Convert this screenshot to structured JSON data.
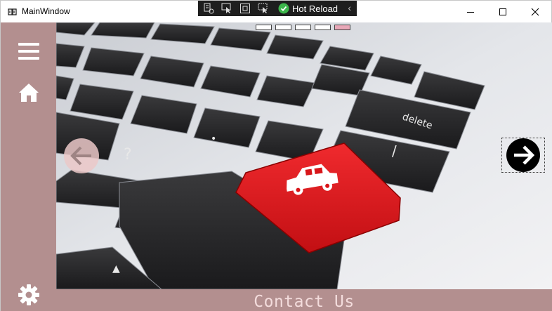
{
  "window": {
    "title": "MainWindow"
  },
  "devbar": {
    "hot_reload_label": "Hot Reload"
  },
  "footer": {
    "contact_label": "Contact Us"
  },
  "carousel": {
    "slide_count": 5,
    "active_index": 4
  },
  "icons": {
    "menu": "hamburger-icon",
    "home": "home-icon",
    "settings": "gear-icon",
    "prev": "arrow-left-icon",
    "next": "arrow-right-icon"
  },
  "colors": {
    "sidebar": "#b38f8f",
    "footer_text": "#f3dcdc",
    "active_dot": "#e8a8b8",
    "key_red": "#e0161b"
  }
}
